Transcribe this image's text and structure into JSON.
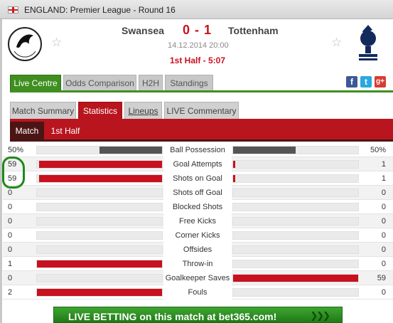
{
  "window": {
    "title": "ENGLAND: Premier League - Round 16"
  },
  "match": {
    "home_team": "Swansea",
    "away_team": "Tottenham",
    "score": "0 - 1",
    "date": "14.12.2014 20:00",
    "status": "1st Half - 5:07"
  },
  "tabs": [
    {
      "label": "Live Centre",
      "active": true
    },
    {
      "label": "Odds Comparison"
    },
    {
      "label": "H2H"
    },
    {
      "label": "Standings"
    }
  ],
  "sub_tabs": [
    {
      "label": "Match Summary"
    },
    {
      "label": "Statistics",
      "active": true
    },
    {
      "label": "Lineups"
    },
    {
      "label": "LIVE Commentary"
    }
  ],
  "period_tabs": [
    {
      "label": "Match",
      "active": true
    },
    {
      "label": "1st Half"
    }
  ],
  "social": {
    "facebook": "f",
    "twitter": "t",
    "google": "g+"
  },
  "stats": [
    {
      "label": "Ball Possession",
      "home": "50%",
      "away": "50%",
      "home_frac": 0.5,
      "away_frac": 0.5,
      "color": "#555555"
    },
    {
      "label": "Goal Attempts",
      "home": "59",
      "away": "1",
      "home_frac": 0.983,
      "away_frac": 0.017,
      "color": "#c8101e"
    },
    {
      "label": "Shots on Goal",
      "home": "59",
      "away": "1",
      "home_frac": 0.983,
      "away_frac": 0.017,
      "color": "#c8101e"
    },
    {
      "label": "Shots off Goal",
      "home": "0",
      "away": "0",
      "home_frac": 0,
      "away_frac": 0,
      "color": "#c8101e"
    },
    {
      "label": "Blocked Shots",
      "home": "0",
      "away": "0",
      "home_frac": 0,
      "away_frac": 0,
      "color": "#c8101e"
    },
    {
      "label": "Free Kicks",
      "home": "0",
      "away": "0",
      "home_frac": 0,
      "away_frac": 0,
      "color": "#c8101e"
    },
    {
      "label": "Corner Kicks",
      "home": "0",
      "away": "0",
      "home_frac": 0,
      "away_frac": 0,
      "color": "#c8101e"
    },
    {
      "label": "Offsides",
      "home": "0",
      "away": "0",
      "home_frac": 0,
      "away_frac": 0,
      "color": "#c8101e"
    },
    {
      "label": "Throw-in",
      "home": "1",
      "away": "0",
      "home_frac": 1,
      "away_frac": 0,
      "color": "#c8101e"
    },
    {
      "label": "Goalkeeper Saves",
      "home": "0",
      "away": "59",
      "home_frac": 0,
      "away_frac": 1,
      "color": "#c8101e"
    },
    {
      "label": "Fouls",
      "home": "2",
      "away": "0",
      "home_frac": 1,
      "away_frac": 0,
      "color": "#c8101e"
    }
  ],
  "banner": {
    "text": "LIVE BETTING on this match at bet365.com!"
  },
  "colors": {
    "accent_green": "#3f8f20",
    "accent_red": "#b9151f",
    "annotation": "#1f8a18"
  }
}
